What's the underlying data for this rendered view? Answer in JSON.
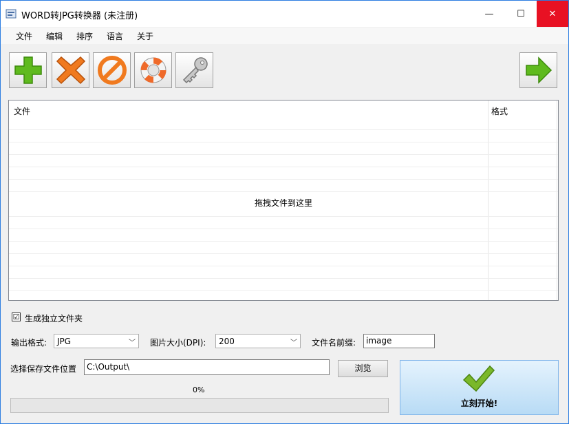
{
  "window": {
    "title": "WORD转JPG转换器 (未注册)"
  },
  "window_buttons": {
    "minimize": "—",
    "maximize": "☐",
    "close": "✕"
  },
  "menu": [
    "文件",
    "编辑",
    "排序",
    "语言",
    "关于"
  ],
  "list": {
    "col_file": "文件",
    "col_format": "格式",
    "drop_hint": "拖拽文件到这里"
  },
  "options": {
    "separate_folder_label": "生成独立文件夹",
    "separate_folder_checked": "☑",
    "output_format_label": "输出格式:",
    "output_format_value": "JPG",
    "dpi_label": "图片大小(DPI):",
    "dpi_value": "200",
    "prefix_label": "文件名前缀:",
    "prefix_value": "image"
  },
  "save": {
    "label": "选择保存文件位置",
    "path": "C:\\Output\\",
    "browse": "浏览"
  },
  "progress": {
    "text": "0%",
    "value": 0
  },
  "start_button": {
    "label": "立刻开始!"
  },
  "colors": {
    "accent": "#2b7de1",
    "green": "#5fba1e",
    "orange": "#f07a1f"
  }
}
